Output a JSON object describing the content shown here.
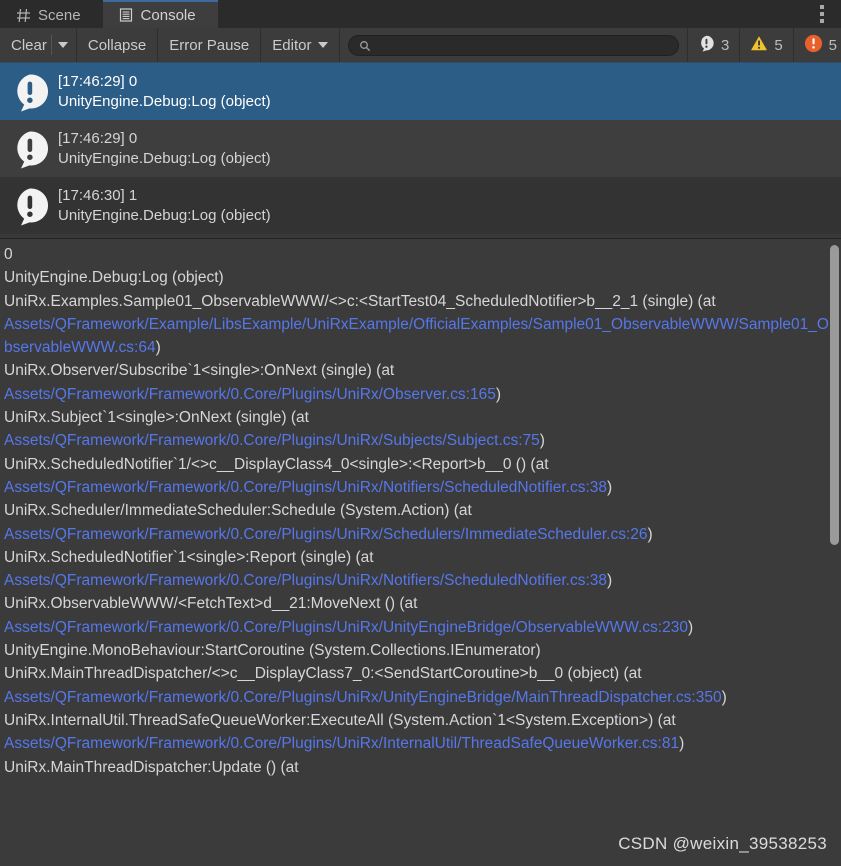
{
  "window": {
    "tabs": [
      {
        "label": "Scene",
        "icon": "grid-icon",
        "active": false
      },
      {
        "label": "Console",
        "icon": "console-icon",
        "active": true
      }
    ],
    "options_menu": "kebab-menu-icon"
  },
  "toolbar": {
    "clear_label": "Clear",
    "clear_dropdown_icon": "chevron-down-icon",
    "collapse_label": "Collapse",
    "error_pause_label": "Error Pause",
    "editor_label": "Editor",
    "editor_dropdown_icon": "chevron-down-icon",
    "search": {
      "value": "",
      "placeholder": "",
      "icon": "search-icon"
    },
    "counters": {
      "info_count": "3",
      "info_icon": "info-bubble-icon",
      "warning_count": "5",
      "warning_icon": "warning-triangle-icon",
      "error_count": "5",
      "error_icon": "error-circle-icon"
    },
    "colors": {
      "warning": "#f2c12e",
      "error": "#e8602c",
      "info_badge": "#e2e2e2",
      "link": "#5577ea",
      "selection": "#2c5d87",
      "tab_accent": "#3e6a9e"
    }
  },
  "log_list": {
    "entries": [
      {
        "icon": "info-bubble-icon",
        "line1": "[17:46:29] 0",
        "line2": "UnityEngine.Debug:Log (object)",
        "selected": true
      },
      {
        "icon": "info-bubble-icon",
        "line1": "[17:46:29] 0",
        "line2": "UnityEngine.Debug:Log (object)",
        "selected": false
      },
      {
        "icon": "info-bubble-icon",
        "line1": "[17:46:30] 1",
        "line2": "UnityEngine.Debug:Log (object)",
        "selected": false
      }
    ]
  },
  "detail": {
    "segments": [
      {
        "text": "0\nUnityEngine.Debug:Log (object)\nUniRx.Examples.Sample01_ObservableWWW/<>c:<StartTest04_ScheduledNotifier>b__2_1 (single) (at\n",
        "link": false
      },
      {
        "text": "Assets/QFramework/Example/LibsExample/UniRxExample/OfficialExamples/Sample01_ObservableWWW/Sample01_ObservableWWW.cs:64",
        "link": true
      },
      {
        "text": ")\nUniRx.Observer/Subscribe`1<single>:OnNext (single) (at\n",
        "link": false
      },
      {
        "text": "Assets/QFramework/Framework/0.Core/Plugins/UniRx/Observer.cs:165",
        "link": true
      },
      {
        "text": ")\nUniRx.Subject`1<single>:OnNext (single) (at\n",
        "link": false
      },
      {
        "text": "Assets/QFramework/Framework/0.Core/Plugins/UniRx/Subjects/Subject.cs:75",
        "link": true
      },
      {
        "text": ")\nUniRx.ScheduledNotifier`1/<>c__DisplayClass4_0<single>:<Report>b__0 () (at\n",
        "link": false
      },
      {
        "text": "Assets/QFramework/Framework/0.Core/Plugins/UniRx/Notifiers/ScheduledNotifier.cs:38",
        "link": true
      },
      {
        "text": ")\nUniRx.Scheduler/ImmediateScheduler:Schedule (System.Action) (at\n",
        "link": false
      },
      {
        "text": "Assets/QFramework/Framework/0.Core/Plugins/UniRx/Schedulers/ImmediateScheduler.cs:26",
        "link": true
      },
      {
        "text": ")\nUniRx.ScheduledNotifier`1<single>:Report (single) (at\n",
        "link": false
      },
      {
        "text": "Assets/QFramework/Framework/0.Core/Plugins/UniRx/Notifiers/ScheduledNotifier.cs:38",
        "link": true
      },
      {
        "text": ")\nUniRx.ObservableWWW/<FetchText>d__21:MoveNext () (at\n",
        "link": false
      },
      {
        "text": "Assets/QFramework/Framework/0.Core/Plugins/UniRx/UnityEngineBridge/ObservableWWW.cs:230",
        "link": true
      },
      {
        "text": ")\nUnityEngine.MonoBehaviour:StartCoroutine (System.Collections.IEnumerator)\nUniRx.MainThreadDispatcher/<>c__DisplayClass7_0:<SendStartCoroutine>b__0 (object) (at\n",
        "link": false
      },
      {
        "text": "Assets/QFramework/Framework/0.Core/Plugins/UniRx/UnityEngineBridge/MainThreadDispatcher.cs:350",
        "link": true
      },
      {
        "text": ")\nUniRx.InternalUtil.ThreadSafeQueueWorker:ExecuteAll (System.Action`1<System.Exception>) (at\n",
        "link": false
      },
      {
        "text": "Assets/QFramework/Framework/0.Core/Plugins/UniRx/InternalUtil/ThreadSafeQueueWorker.cs:81",
        "link": true
      },
      {
        "text": ")\nUniRx.MainThreadDispatcher:Update () (at",
        "link": false
      }
    ],
    "watermark": "CSDN @weixin_39538253"
  }
}
